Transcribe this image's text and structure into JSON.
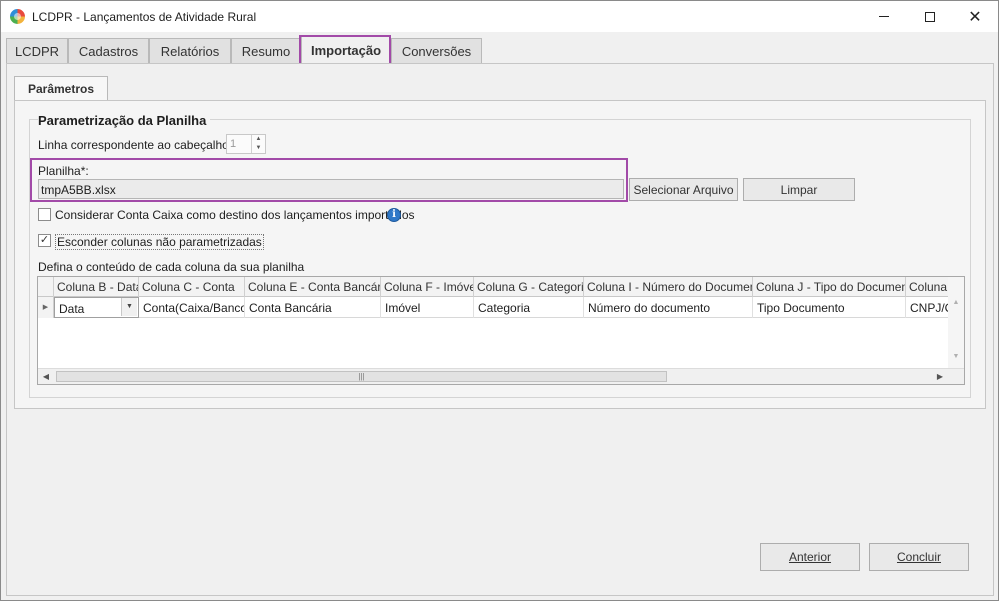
{
  "window": {
    "title": "LCDPR - Lançamentos de Atividade Rural",
    "icon": "app-logo-icon"
  },
  "main_tabs": [
    {
      "label": "LCDPR",
      "active": false
    },
    {
      "label": "Cadastros",
      "active": false
    },
    {
      "label": "Relatórios",
      "active": false
    },
    {
      "label": "Resumo",
      "active": false
    },
    {
      "label": "Importação",
      "active": true
    },
    {
      "label": "Conversões",
      "active": false
    }
  ],
  "sub_tab": {
    "label": "Parâmetros"
  },
  "group": {
    "title": "Parametrização da Planilha",
    "header_line_label": "Linha correspondente ao cabeçalho*",
    "header_line_value": "1",
    "sheet_label": "Planilha*:",
    "sheet_value": "tmpA5BB.xlsx",
    "select_file_button": "Selecionar Arquivo",
    "clear_button": "Limpar",
    "checkbox_cash": {
      "label": "Considerar Conta Caixa como destino dos lançamentos importados",
      "checked": false
    },
    "checkbox_hide": {
      "label": "Esconder colunas não parametrizadas",
      "checked": true
    },
    "grid_caption": "Defina o conteúdo de cada coluna da sua planilha"
  },
  "grid": {
    "columns": [
      "Coluna B - Data",
      "Coluna C - Conta",
      "Coluna E - Conta Bancária",
      "Coluna F - Imóvel",
      "Coluna G - Categoria",
      "Coluna I - Número do Documento",
      "Coluna J - Tipo do Documento",
      "Coluna K - C"
    ],
    "row": [
      "Data",
      "Conta(Caixa/Banco)",
      "Conta Bancária",
      "Imóvel",
      "Categoria",
      "Número do documento",
      "Tipo Documento",
      "CNPJ/Cl"
    ]
  },
  "footer": {
    "back_button": "Anterior",
    "finish_button": "Concluir"
  },
  "colors": {
    "highlight": "#a24aa8",
    "info_icon": "#2f78c8"
  }
}
